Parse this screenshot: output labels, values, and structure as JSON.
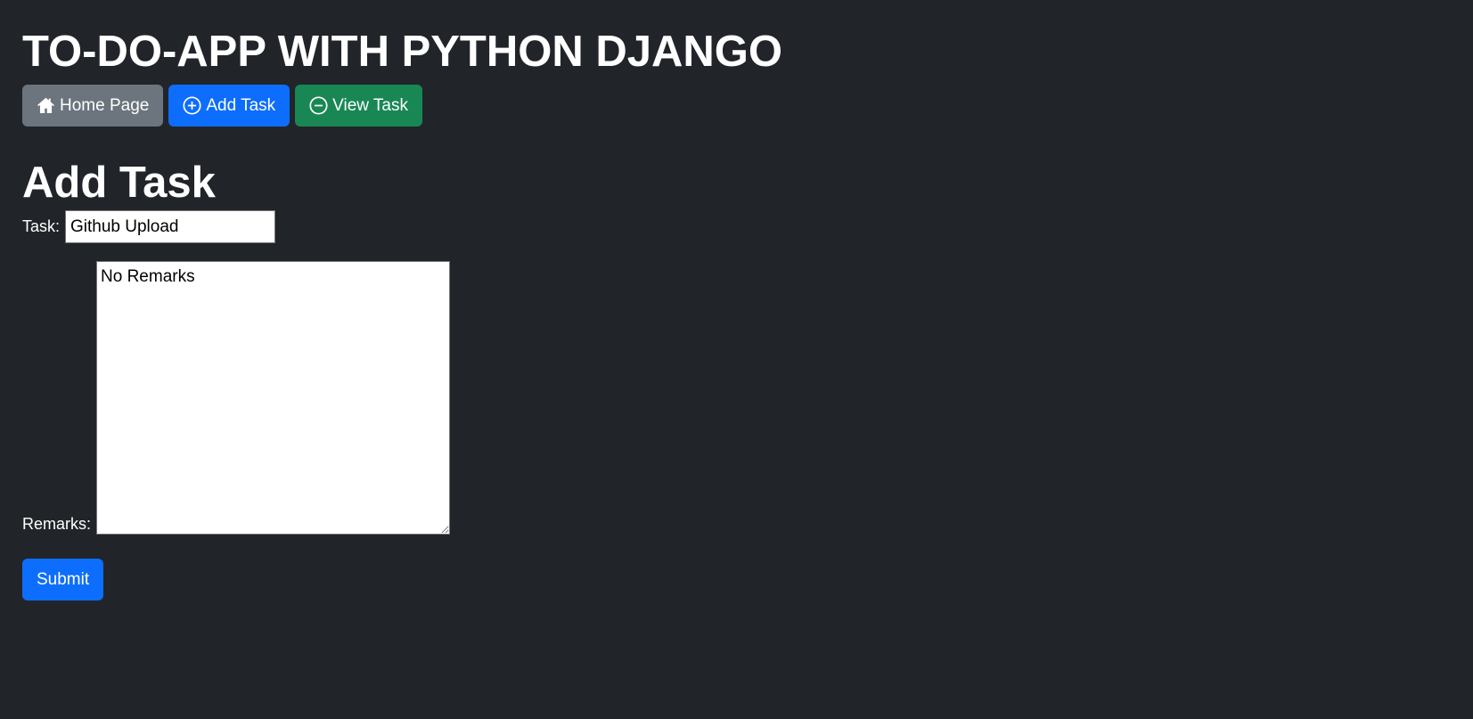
{
  "header": {
    "title": "TO-DO-APP WITH PYTHON DJANGO"
  },
  "nav": {
    "home_label": "Home Page",
    "add_label": "Add Task",
    "view_label": "View Task",
    "home_icon": "house-icon",
    "add_icon": "plus-circle-icon",
    "view_icon": "minus-circle-icon"
  },
  "form": {
    "heading": "Add Task",
    "task_label": "Task:",
    "task_value": "Github Upload",
    "remarks_label": "Remarks:",
    "remarks_value": "No Remarks",
    "submit_label": "Submit"
  },
  "colors": {
    "background": "#212529",
    "secondary": "#6c757d",
    "primary": "#0d6efd",
    "success": "#198754"
  }
}
